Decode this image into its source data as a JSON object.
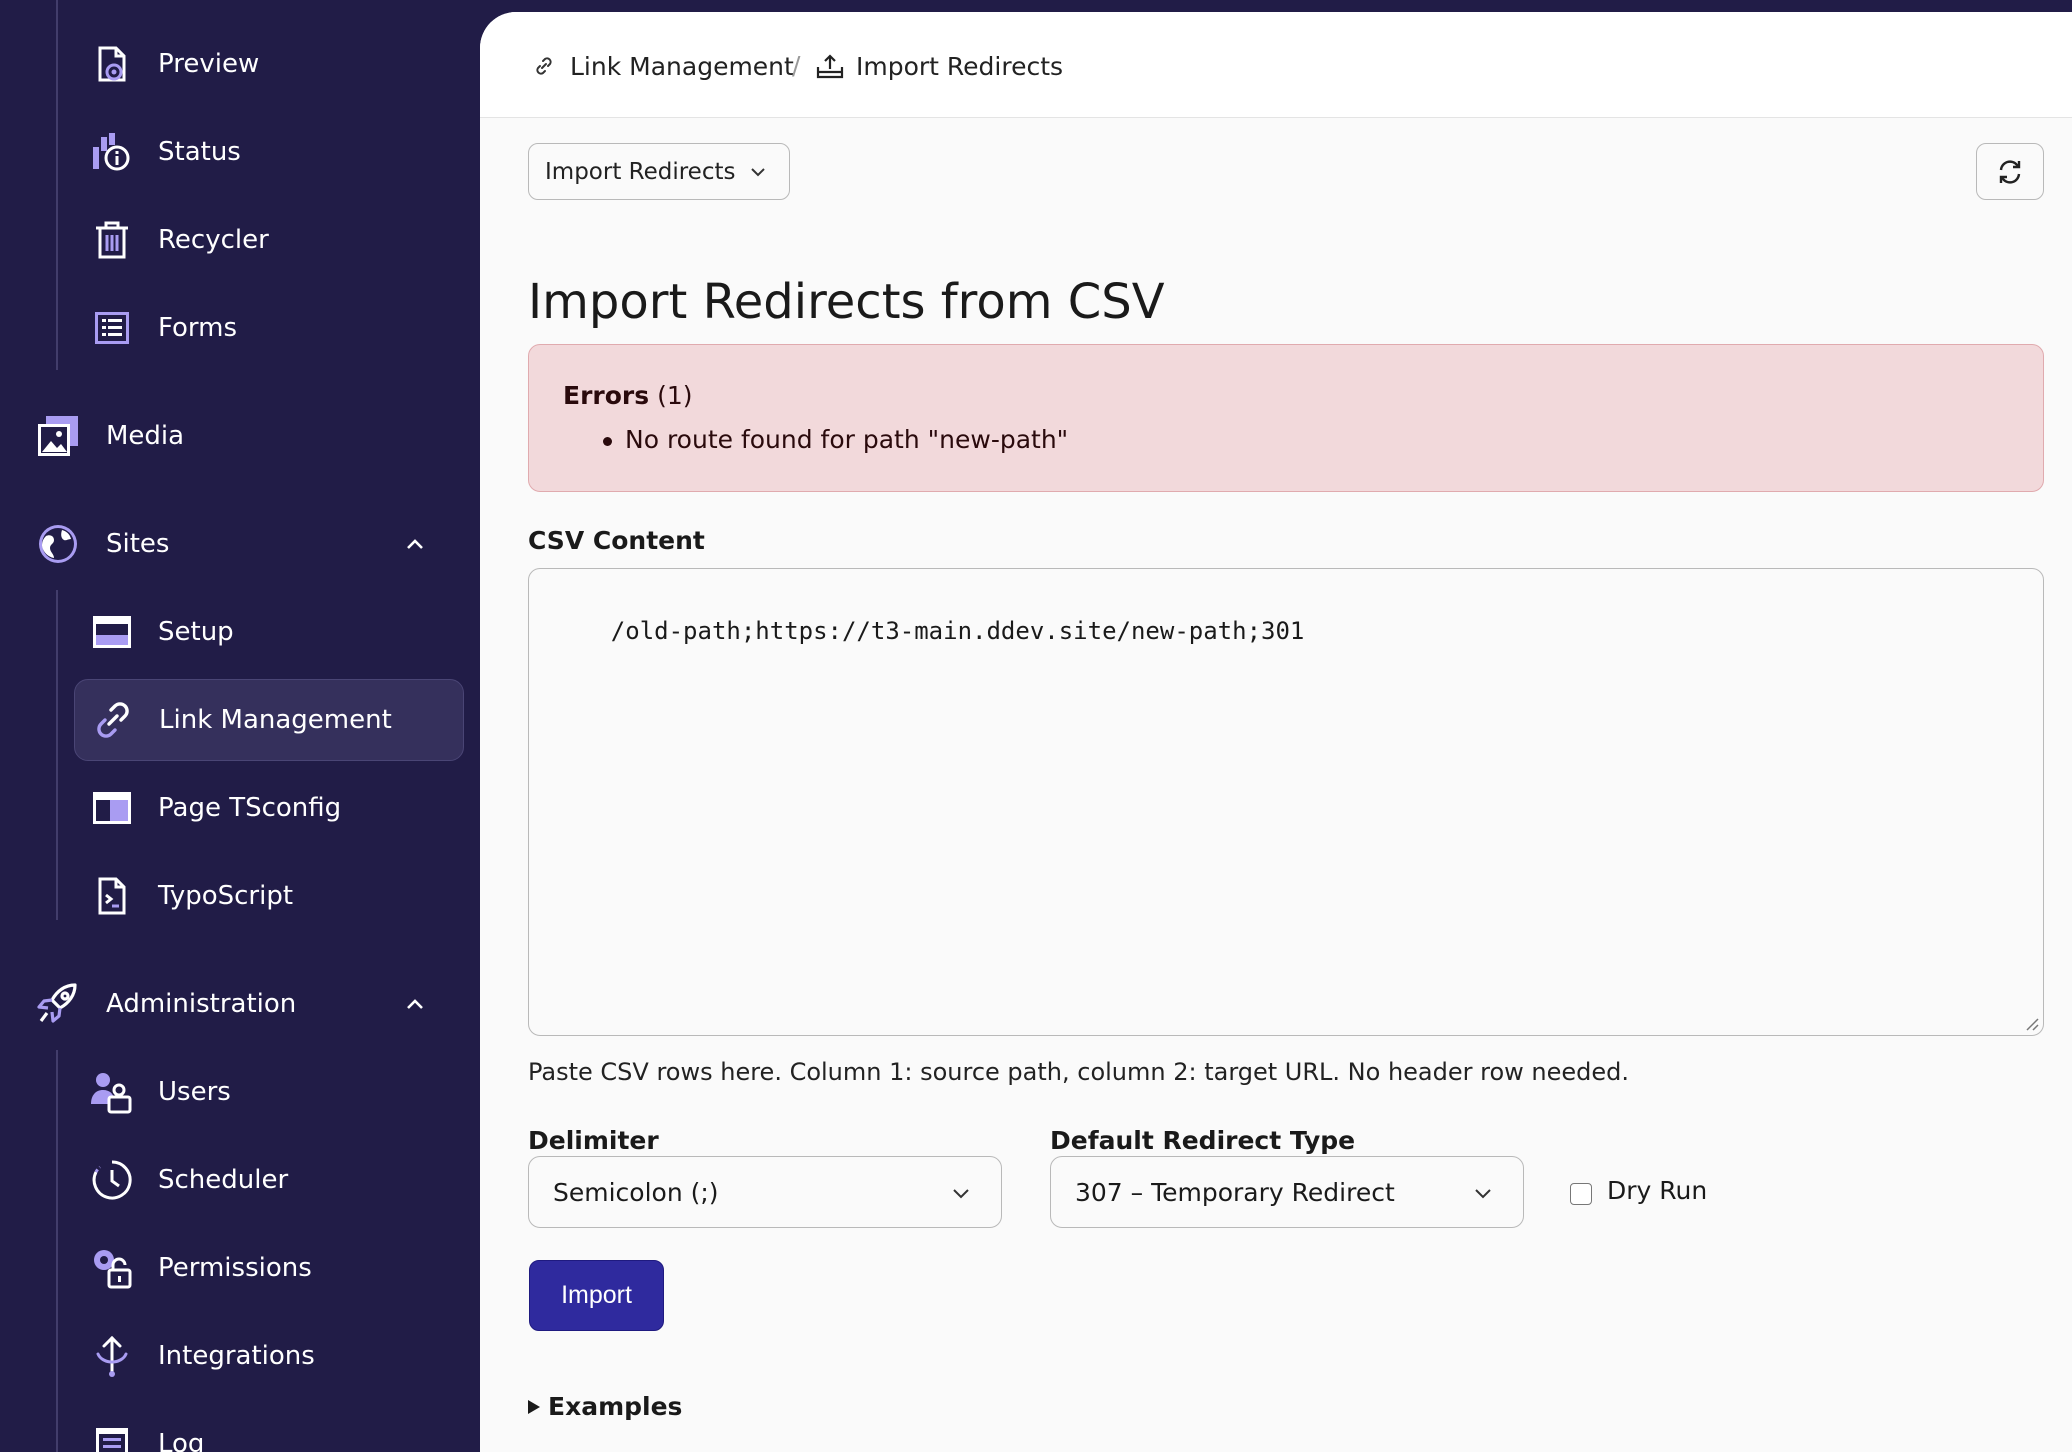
{
  "sidebar": {
    "items": [
      {
        "label": "Preview",
        "icon": "preview-icon"
      },
      {
        "label": "Status",
        "icon": "status-icon"
      },
      {
        "label": "Recycler",
        "icon": "recycler-icon"
      },
      {
        "label": "Forms",
        "icon": "forms-icon"
      },
      {
        "label": "Media",
        "icon": "media-icon"
      },
      {
        "label": "Sites",
        "icon": "sites-icon"
      },
      {
        "label": "Setup",
        "icon": "setup-icon"
      },
      {
        "label": "Link Management",
        "icon": "link-icon"
      },
      {
        "label": "Page TSconfig",
        "icon": "page-tsconfig-icon"
      },
      {
        "label": "TypoScript",
        "icon": "typoscript-icon"
      },
      {
        "label": "Administration",
        "icon": "administration-icon"
      },
      {
        "label": "Users",
        "icon": "users-icon"
      },
      {
        "label": "Scheduler",
        "icon": "scheduler-icon"
      },
      {
        "label": "Permissions",
        "icon": "permissions-icon"
      },
      {
        "label": "Integrations",
        "icon": "integrations-icon"
      },
      {
        "label": "Log",
        "icon": "log-icon"
      }
    ],
    "active": "Link Management"
  },
  "breadcrumb": {
    "items": [
      {
        "label": "Link Management",
        "icon": "link-icon"
      },
      {
        "label": "Import Redirects",
        "icon": "upload-icon"
      }
    ],
    "separator": "/"
  },
  "toolbar": {
    "module_menu_label": "Import Redirects",
    "refresh_icon": "refresh-icon"
  },
  "page": {
    "title": "Import Redirects from CSV"
  },
  "errors": {
    "title": "Errors",
    "count": "(1)",
    "items": [
      "No route found for path \"new-path\""
    ]
  },
  "form": {
    "csv_label": "CSV Content",
    "csv_value": "/old-path;https://t3-main.ddev.site/new-path;301",
    "csv_help": "Paste CSV rows here. Column 1: source path, column 2: target URL. No header row needed.",
    "delimiter_label": "Delimiter",
    "delimiter_value": "Semicolon (;)",
    "redirect_type_label": "Default Redirect Type",
    "redirect_type_value": "307 – Temporary Redirect",
    "dry_run_label": "Dry Run",
    "dry_run_checked": false,
    "import_label": "Import",
    "examples_label": "Examples"
  },
  "colors": {
    "sidebar_bg": "#211c47",
    "active_item_bg": "#35305c",
    "primary": "#2f2a9e",
    "error_bg": "#f2d9db",
    "error_border": "#e0aaae",
    "icon_accent": "#a99cf2"
  }
}
